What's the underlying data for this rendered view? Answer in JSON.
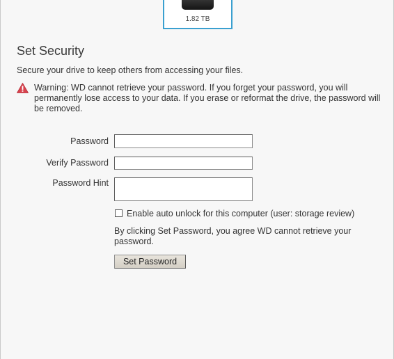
{
  "drive": {
    "capacity": "1.82 TB"
  },
  "security": {
    "title": "Set Security",
    "description": "Secure your drive to keep others from accessing your files.",
    "warning": "Warning: WD cannot retrieve your password. If you forget your password, you will permanently lose access to your data. If you erase or reformat the drive, the password will be removed."
  },
  "form": {
    "password_label": "Password",
    "password_value": "",
    "verify_label": "Verify Password",
    "verify_value": "",
    "hint_label": "Password Hint",
    "hint_value": "",
    "auto_unlock_label": "Enable auto unlock for this computer (user: storage review)",
    "auto_unlock_checked": false,
    "agreement": "By clicking Set Password, you agree WD cannot retrieve your password.",
    "submit_label": "Set Password"
  },
  "colors": {
    "selection_border": "#3aa0d0",
    "warning_icon": "#d9434e"
  },
  "icons": {
    "warning": "warning-triangle-icon",
    "drive": "external-drive-icon"
  }
}
